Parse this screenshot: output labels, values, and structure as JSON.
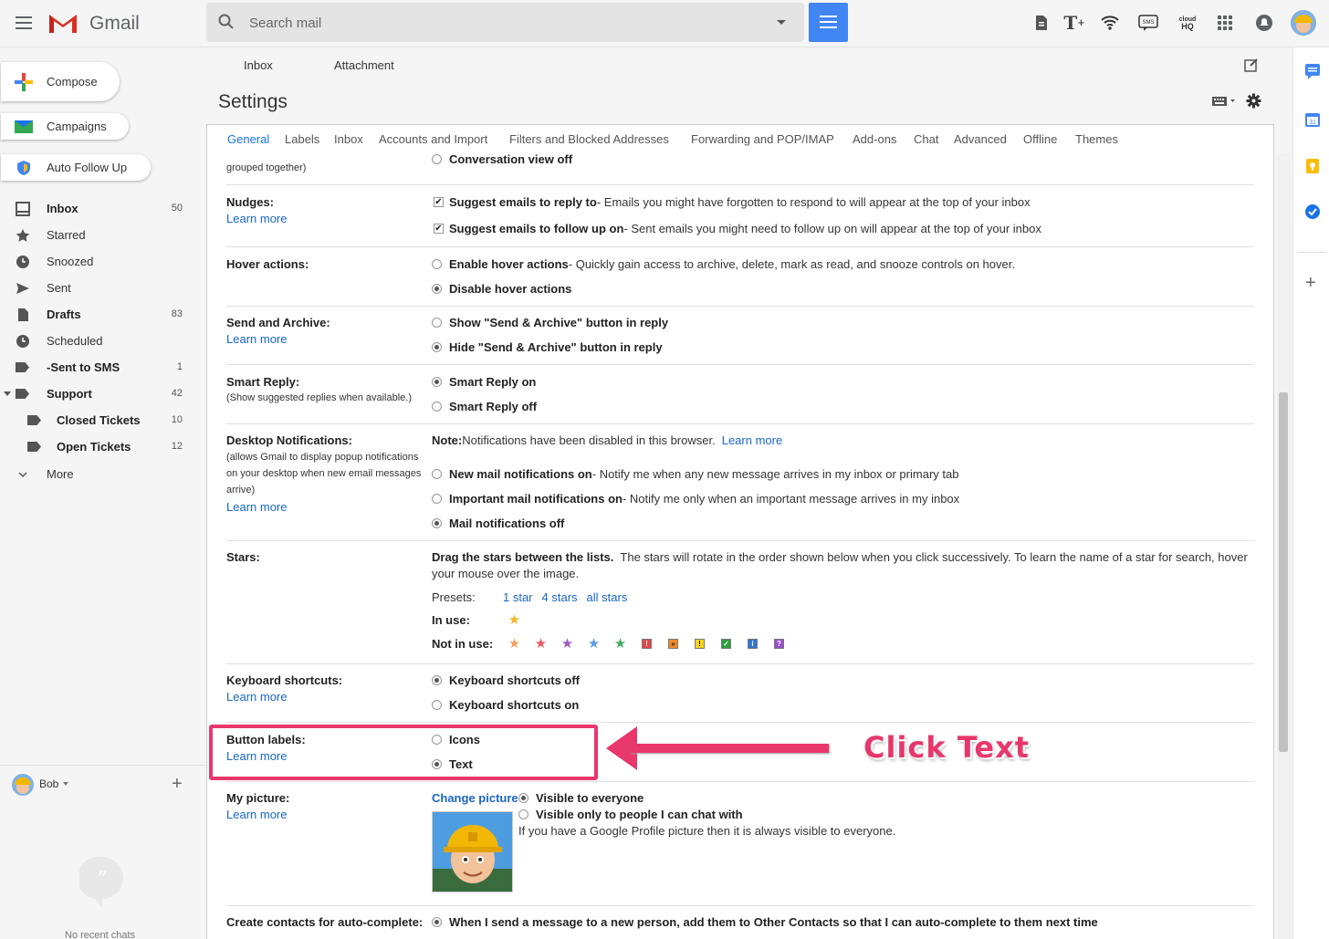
{
  "header": {
    "app_name": "Gmail",
    "search_placeholder": "Search mail"
  },
  "compose": {
    "label": "Compose"
  },
  "extensions": [
    {
      "label": "Campaigns"
    },
    {
      "label": "Auto Follow Up"
    }
  ],
  "nav": [
    {
      "label": "Inbox",
      "count": "50",
      "icon": "inbox-icon"
    },
    {
      "label": "Starred",
      "count": "",
      "icon": "star-icon"
    },
    {
      "label": "Snoozed",
      "count": "",
      "icon": "clock-icon"
    },
    {
      "label": "Sent",
      "count": "",
      "icon": "send-icon"
    },
    {
      "label": "Drafts",
      "count": "83",
      "icon": "draft-icon"
    },
    {
      "label": "Scheduled",
      "count": "",
      "icon": "clock-icon"
    },
    {
      "label": "-Sent to SMS",
      "count": "1",
      "icon": "label-icon"
    },
    {
      "label": "Support",
      "count": "42",
      "icon": "label-icon"
    },
    {
      "label": "Closed Tickets",
      "count": "10",
      "icon": "label-icon"
    },
    {
      "label": "Open Tickets",
      "count": "12",
      "icon": "label-icon"
    },
    {
      "label": "More",
      "count": "",
      "icon": "chevron-down-icon"
    }
  ],
  "hangouts": {
    "user": "Bob",
    "no_chats": "No recent chats"
  },
  "toolbar": {
    "tab_inbox": "Inbox",
    "tab_attachment": "Attachment"
  },
  "settings": {
    "title": "Settings",
    "tabs": [
      "General",
      "Labels",
      "Inbox",
      "Accounts and Import",
      "Filters and Blocked Addresses",
      "Forwarding and POP/IMAP",
      "Add-ons",
      "Chat",
      "Advanced",
      "Offline",
      "Themes"
    ],
    "partial_top": {
      "sub": "grouped together)",
      "option": "Conversation view off"
    },
    "learn_more": "Learn more",
    "nudges": {
      "label": "Nudges:",
      "opt1_bold": "Suggest emails to reply to",
      "opt1_rest": " - Emails you might have forgotten to respond to will appear at the top of your inbox",
      "opt2_bold": "Suggest emails to follow up on",
      "opt2_rest": " - Sent emails you might need to follow up on will appear at the top of your inbox"
    },
    "hover": {
      "label": "Hover actions:",
      "opt1_bold": "Enable hover actions",
      "opt1_rest": " - Quickly gain access to archive, delete, mark as read, and snooze controls on hover.",
      "opt2_bold": "Disable hover actions"
    },
    "send_archive": {
      "label": "Send and Archive:",
      "opt1": "Show \"Send & Archive\" button in reply",
      "opt2": "Hide \"Send & Archive\" button in reply"
    },
    "smart_reply": {
      "label": "Smart Reply:",
      "sub": "(Show suggested replies when available.)",
      "opt1": "Smart Reply on",
      "opt2": "Smart Reply off"
    },
    "desktop": {
      "label": "Desktop Notifications:",
      "sub1": "(allows Gmail to display popup notifications",
      "sub2": "on your desktop when new email messages",
      "sub3": "arrive)",
      "note_bold": "Note:",
      "note_rest": " Notifications have been disabled in this browser.",
      "opt1_bold": "New mail notifications on",
      "opt1_rest": " - Notify me when any new message arrives in my inbox or primary tab",
      "opt2_bold": "Important mail notifications on",
      "opt2_rest": " - Notify me only when an important message arrives in my inbox",
      "opt3_bold": "Mail notifications off"
    },
    "stars": {
      "label": "Stars:",
      "desc_bold": "Drag the stars between the lists.",
      "desc_rest1": "  The stars will rotate in the order shown below when you click successively. To learn the name of a star for search, hover",
      "desc_rest2": "your mouse over the image.",
      "presets_label": "Presets:",
      "preset1": "1 star",
      "preset2": "4 stars",
      "preset3": "all stars",
      "in_use": "In use:",
      "not_in_use": "Not in use:"
    },
    "keyboard": {
      "label": "Keyboard shortcuts:",
      "opt1": "Keyboard shortcuts off",
      "opt2": "Keyboard shortcuts on"
    },
    "button_labels": {
      "label": "Button labels:",
      "opt1": "Icons",
      "opt2": "Text"
    },
    "my_picture": {
      "label": "My picture:",
      "change": "Change picture",
      "opt1": "Visible to everyone",
      "opt2": "Visible only to people I can chat with",
      "note": "If you have a Google Profile picture then it is always visible to everyone."
    },
    "contacts": {
      "label": "Create contacts for auto-complete:",
      "opt1": "When I send a message to a new person, add them to Other Contacts so that I can auto-complete to them next time"
    }
  },
  "annotation": {
    "text": "Click Text",
    "color": "#e8376b"
  },
  "colors": {
    "accent": "#4285f4",
    "link": "#1a66c4",
    "annotation": "#e8376b"
  }
}
